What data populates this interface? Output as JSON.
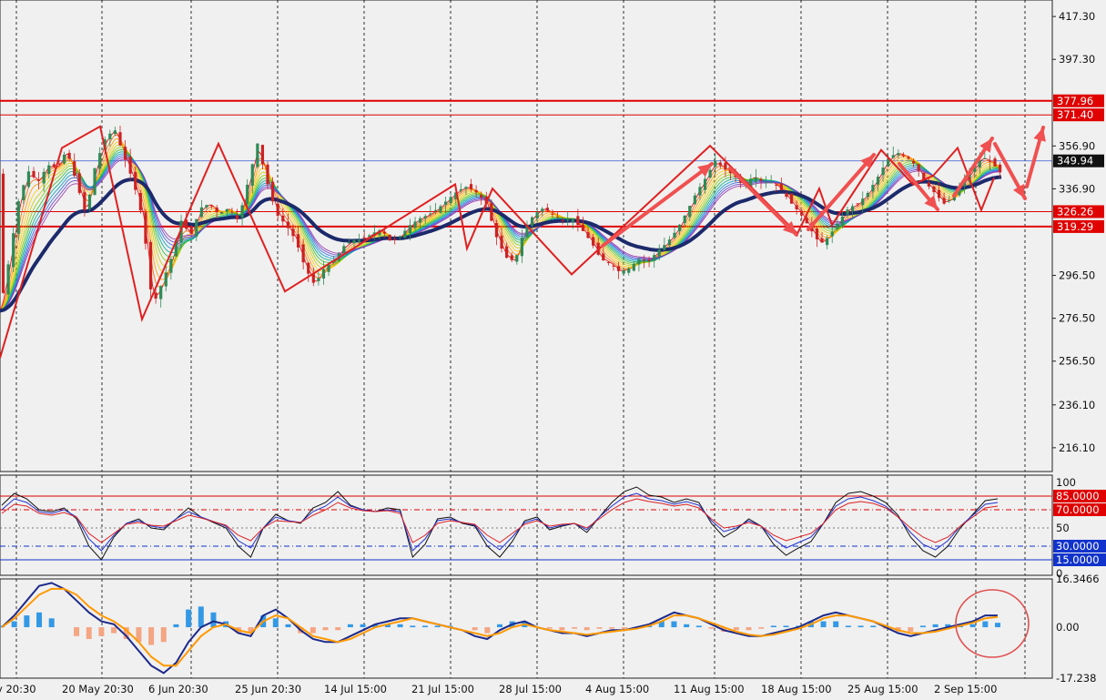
{
  "colors": {
    "background": "#f0f0f0",
    "grid": "#000000",
    "bull_candle": "#2e8b57",
    "bear_candle": "#cc2222",
    "slow_ma": "#1c2a6b",
    "zigzag": "#e02020",
    "arrow": "#f05050",
    "resistance": "#e00000",
    "current_line": "#3355cc",
    "rsi_black": "#111111",
    "rsi_blue": "#2233cc",
    "rsi_red": "#dd2222",
    "macd_line": "#1c2a8b",
    "signal_line": "#ff9900",
    "hist_pos": "#3399e6",
    "hist_neg": "#f4a582",
    "level_red_badge": "#e00000",
    "level_blue_badge": "#1133cc",
    "price_badge": "#111111"
  },
  "chart_data": [
    {
      "type": "candlestick",
      "panel": "price",
      "ylim": [
        205,
        425
      ],
      "y_ticks": [
        "417.30",
        "397.30",
        "356.90",
        "336.90",
        "296.50",
        "276.50",
        "256.50",
        "236.10",
        "216.10"
      ],
      "x_tick_labels": [
        "y 20:30",
        "20 May 20:30",
        "6 Jun 20:30",
        "25 Jun 20:30",
        "14 Jul 15:00",
        "21 Jul 15:00",
        "28 Jul 15:00",
        "4 Aug 15:00",
        "11 Aug 15:00",
        "18 Aug 15:00",
        "25 Aug 15:00",
        "2 Sep 15:00"
      ],
      "current_price": 349.94,
      "current_price_label": "349.94",
      "horizontal_levels": [
        {
          "value": 377.96,
          "label": "377.96",
          "thick": true
        },
        {
          "value": 371.4,
          "label": "371.40",
          "thick": false
        },
        {
          "value": 326.26,
          "label": "326.26",
          "thick": false
        },
        {
          "value": 319.29,
          "label": "319.29",
          "thick": true
        }
      ],
      "close_path": [
        [
          0,
          280
        ],
        [
          6,
          305
        ],
        [
          12,
          333
        ],
        [
          18,
          345
        ],
        [
          24,
          340
        ],
        [
          30,
          348
        ],
        [
          36,
          347
        ],
        [
          42,
          355
        ],
        [
          48,
          340
        ],
        [
          54,
          325
        ],
        [
          60,
          348
        ],
        [
          66,
          360
        ],
        [
          72,
          365
        ],
        [
          78,
          352
        ],
        [
          84,
          340
        ],
        [
          90,
          322
        ],
        [
          96,
          282
        ],
        [
          102,
          293
        ],
        [
          108,
          305
        ],
        [
          114,
          322
        ],
        [
          120,
          315
        ],
        [
          126,
          328
        ],
        [
          132,
          330
        ],
        [
          138,
          325
        ],
        [
          144,
          328
        ],
        [
          150,
          322
        ],
        [
          156,
          340
        ],
        [
          162,
          358
        ],
        [
          168,
          340
        ],
        [
          174,
          325
        ],
        [
          180,
          320
        ],
        [
          186,
          313
        ],
        [
          192,
          300
        ],
        [
          198,
          292
        ],
        [
          204,
          300
        ],
        [
          210,
          303
        ],
        [
          216,
          310
        ],
        [
          222,
          313
        ],
        [
          228,
          313
        ],
        [
          234,
          316
        ],
        [
          240,
          318
        ],
        [
          246,
          312
        ],
        [
          252,
          315
        ],
        [
          258,
          320
        ],
        [
          264,
          323
        ],
        [
          270,
          325
        ],
        [
          276,
          328
        ],
        [
          282,
          332
        ],
        [
          288,
          336
        ],
        [
          294,
          338
        ],
        [
          300,
          335
        ],
        [
          306,
          330
        ],
        [
          312,
          315
        ],
        [
          318,
          305
        ],
        [
          324,
          303
        ],
        [
          330,
          318
        ],
        [
          336,
          325
        ],
        [
          342,
          328
        ],
        [
          348,
          325
        ],
        [
          354,
          322
        ],
        [
          360,
          323
        ],
        [
          366,
          318
        ],
        [
          372,
          312
        ],
        [
          378,
          304
        ],
        [
          384,
          302
        ],
        [
          390,
          298
        ],
        [
          396,
          300
        ],
        [
          402,
          304
        ],
        [
          408,
          303
        ],
        [
          414,
          308
        ],
        [
          420,
          312
        ],
        [
          426,
          318
        ],
        [
          432,
          326
        ],
        [
          438,
          335
        ],
        [
          444,
          342
        ],
        [
          450,
          350
        ],
        [
          456,
          346
        ],
        [
          462,
          343
        ],
        [
          468,
          338
        ],
        [
          474,
          343
        ],
        [
          480,
          340
        ],
        [
          486,
          340
        ],
        [
          492,
          336
        ],
        [
          498,
          330
        ],
        [
          504,
          325
        ],
        [
          510,
          318
        ],
        [
          516,
          311
        ],
        [
          522,
          315
        ],
        [
          528,
          322
        ],
        [
          534,
          328
        ],
        [
          540,
          330
        ],
        [
          546,
          335
        ],
        [
          552,
          342
        ],
        [
          558,
          350
        ],
        [
          564,
          354
        ],
        [
          570,
          352
        ],
        [
          576,
          348
        ],
        [
          582,
          340
        ],
        [
          588,
          335
        ],
        [
          594,
          330
        ],
        [
          600,
          333
        ],
        [
          606,
          340
        ],
        [
          612,
          346
        ],
        [
          618,
          352
        ],
        [
          624,
          349
        ],
        [
          630,
          344
        ]
      ],
      "fast_ma_count": 12
    },
    {
      "type": "line",
      "panel": "oscillator",
      "ylim": [
        0,
        100
      ],
      "y_ticks": [
        "100",
        "50",
        "0"
      ],
      "levels": [
        {
          "value": 85,
          "label": "85.0000",
          "color": "red"
        },
        {
          "value": 70,
          "label": "70.0000",
          "color": "red"
        },
        {
          "value": 30,
          "label": "30.0000",
          "color": "blue"
        },
        {
          "value": 15,
          "label": "15.0000",
          "color": "blue"
        }
      ],
      "series": [
        {
          "color": "black",
          "values": [
            75,
            88,
            82,
            70,
            68,
            72,
            60,
            30,
            15,
            40,
            55,
            60,
            50,
            48,
            60,
            72,
            62,
            56,
            50,
            30,
            18,
            50,
            65,
            58,
            55,
            72,
            78,
            90,
            75,
            70,
            68,
            72,
            70,
            18,
            32,
            60,
            62,
            55,
            52,
            30,
            18,
            35,
            58,
            62,
            48,
            52,
            55,
            45,
            62,
            78,
            90,
            95,
            86,
            84,
            78,
            82,
            78,
            55,
            40,
            48,
            60,
            52,
            32,
            20,
            28,
            35,
            55,
            78,
            88,
            90,
            85,
            78,
            64,
            40,
            25,
            18,
            30,
            50,
            65,
            80,
            82
          ]
        },
        {
          "color": "blue",
          "values": [
            70,
            82,
            78,
            68,
            66,
            70,
            62,
            38,
            25,
            42,
            55,
            58,
            52,
            50,
            60,
            68,
            62,
            57,
            52,
            36,
            28,
            50,
            62,
            58,
            56,
            68,
            74,
            84,
            74,
            70,
            68,
            70,
            68,
            25,
            38,
            58,
            60,
            56,
            53,
            36,
            26,
            40,
            56,
            60,
            50,
            53,
            55,
            48,
            62,
            74,
            84,
            88,
            82,
            80,
            76,
            79,
            75,
            58,
            46,
            50,
            58,
            52,
            38,
            28,
            34,
            40,
            55,
            74,
            82,
            84,
            80,
            74,
            62,
            45,
            32,
            26,
            36,
            52,
            64,
            76,
            78
          ]
        },
        {
          "color": "red",
          "values": [
            66,
            76,
            74,
            66,
            64,
            67,
            62,
            44,
            34,
            44,
            54,
            56,
            53,
            52,
            58,
            64,
            61,
            57,
            53,
            42,
            36,
            50,
            58,
            57,
            56,
            64,
            70,
            78,
            72,
            69,
            68,
            69,
            66,
            34,
            42,
            55,
            58,
            56,
            54,
            42,
            34,
            44,
            54,
            58,
            52,
            54,
            55,
            50,
            60,
            70,
            78,
            82,
            79,
            77,
            74,
            76,
            72,
            60,
            50,
            52,
            56,
            52,
            42,
            36,
            40,
            44,
            55,
            70,
            77,
            79,
            77,
            72,
            62,
            50,
            40,
            34,
            40,
            52,
            62,
            72,
            74
          ]
        }
      ]
    },
    {
      "type": "bar",
      "panel": "macd",
      "ylim": [
        -17.238,
        16.3466
      ],
      "y_ticks": [
        "16.3466",
        "0.00",
        "-17.238"
      ],
      "macd_line": [
        0.0,
        4,
        9,
        14,
        15,
        13,
        9,
        5,
        2,
        1,
        -3,
        -8,
        -13,
        -15.5,
        -12,
        -5,
        0,
        2,
        1,
        -2,
        -3,
        4,
        6,
        3,
        -1,
        -4,
        -5,
        -5,
        -3,
        -1,
        1,
        2,
        3,
        3,
        2,
        1,
        0,
        -1,
        -3,
        -4,
        -1,
        1,
        2,
        0,
        -1,
        -2,
        -2,
        -3,
        -2,
        -1,
        -1,
        0,
        1,
        3,
        5,
        4,
        3,
        1,
        -1,
        -2,
        -3,
        -3,
        -2,
        -1,
        0,
        2,
        4,
        5,
        4,
        3,
        2,
        0,
        -2,
        -3,
        -2,
        -1,
        0,
        1,
        2,
        4,
        4
      ],
      "signal_line": [
        0.0,
        3,
        7,
        11,
        13,
        13,
        11,
        7,
        4,
        2,
        -1,
        -5,
        -10,
        -13,
        -13,
        -8,
        -3,
        0,
        1,
        -1,
        -2,
        2,
        4,
        3,
        0,
        -3,
        -4,
        -5,
        -4,
        -2,
        0,
        1,
        2,
        3,
        2,
        1,
        0,
        -1,
        -2,
        -3,
        -2,
        0,
        1,
        0,
        -1,
        -1.5,
        -2,
        -2.5,
        -2,
        -1.5,
        -1,
        -0.5,
        0.5,
        2,
        4,
        4,
        3,
        1.5,
        0,
        -1.5,
        -2.5,
        -3,
        -2.5,
        -1.5,
        -0.5,
        1,
        3,
        4,
        4,
        3,
        2,
        0.5,
        -1,
        -2,
        -2,
        -1.5,
        -0.5,
        0.5,
        1.5,
        3,
        3.5
      ],
      "histogram": [
        0.5,
        2,
        4,
        5,
        3,
        0,
        -3,
        -4,
        -3,
        -2,
        -4,
        -5,
        -6,
        -5,
        1,
        6,
        7,
        5,
        2,
        -2,
        -2,
        4,
        3,
        1,
        -2,
        -2,
        -1,
        -1,
        1,
        1,
        1,
        1,
        1,
        0.5,
        0.5,
        0.5,
        0.5,
        0,
        -1,
        -2,
        1,
        2,
        2,
        0,
        -0.5,
        -1,
        -0.5,
        -1,
        -0.5,
        -0.5,
        -0.5,
        -0.5,
        0.5,
        2,
        2,
        1,
        0.5,
        -0.5,
        -1.5,
        -1,
        -1,
        -0.5,
        0.5,
        0.5,
        0.5,
        2,
        2,
        2,
        0.5,
        0.5,
        0.5,
        -0.5,
        -1.5,
        -1.5,
        0.5,
        1,
        1,
        1,
        1,
        2,
        1.5
      ]
    }
  ]
}
